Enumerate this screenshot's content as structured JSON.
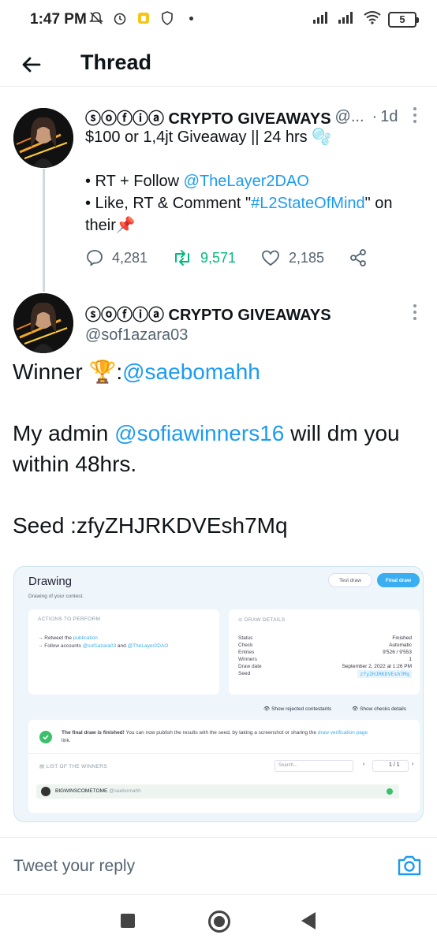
{
  "status_bar": {
    "time": "1:47 PM",
    "battery": "5"
  },
  "header": {
    "title": "Thread"
  },
  "tweet1": {
    "author_name": "ⓢⓞⓕⓘⓐ CRYPTO GIVEAWAYS",
    "handle": "@...",
    "time": "1d",
    "line1": "$100 or 1,4jt Giveaway || 24 hrs 🫧",
    "bullet1_prefix": "• RT + Follow ",
    "bullet1_link": "@TheLayer2DAO",
    "bullet2_prefix": "• Like, RT & Comment \"",
    "bullet2_link": "#L2StateOfMind",
    "bullet2_suffix": "\" on",
    "line_last": "their📌",
    "replies": "4,281",
    "retweets": "9,571",
    "likes": "2,185"
  },
  "tweet2": {
    "author_name": "ⓢⓞⓕⓘⓐ CRYPTO GIVEAWAYS",
    "handle": "@sof1azara03",
    "winner_prefix": "Winner 🏆:",
    "winner_link": "@saebomahh",
    "admin_prefix": "My admin ",
    "admin_link": "@sofiawinners16",
    "admin_suffix": " will dm you within 48hrs.",
    "seed": "Seed :zfyZHJRKDVEsh7Mq"
  },
  "screenshot": {
    "title": "Drawing",
    "subtitle": "Drawing of your contest.",
    "test_draw": "Test draw",
    "final_draw": "Final draw",
    "actions_header": "ACTIONS TO PERFORM",
    "action1_prefix": "→  Retweet the ",
    "action1_link": "publication",
    "action2_prefix": "→  Follow accounts ",
    "action2_link1": "@sof1azara03",
    "action2_mid": " and ",
    "action2_link2": "@TheLayer2DAO",
    "details_header": "DRAW DETAILS",
    "details": [
      {
        "k": "Status",
        "v": "Finished"
      },
      {
        "k": "Check",
        "v": "Automatic"
      },
      {
        "k": "Entries",
        "v": "9'526 / 9'553"
      },
      {
        "k": "Winners",
        "v": "1"
      },
      {
        "k": "Draw date",
        "v": "September 2, 2022 at 1:26 PM"
      },
      {
        "k": "Seed",
        "v": "zfyZHJRKDVEsh7Mq"
      }
    ],
    "show_rejected": "Show rejected contestants",
    "show_checks": "Show checks details",
    "final_msg_bold": "The final draw is finished!",
    "final_msg": " You can now publish the results with the seed, by taking a screenshot or sharing the ",
    "final_msg_link": "draw verification page",
    "final_msg_end": "link.",
    "winners_header": "LIST OF THE WINNERS",
    "search_placeholder": "Search...",
    "pager": "1  /  1",
    "winner_name": "BIGWINSCOMETOME",
    "winner_handle": "@saebomahh"
  },
  "reply": {
    "placeholder": "Tweet your reply"
  },
  "colors": {
    "link": "#1d9bf0",
    "retweet": "#00ba7c",
    "muted": "#536471"
  }
}
